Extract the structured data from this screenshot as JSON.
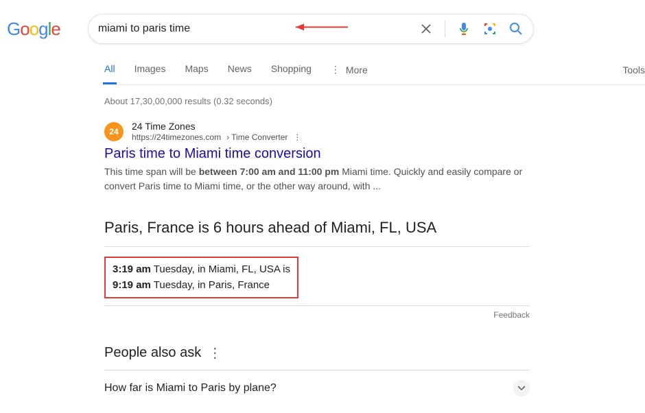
{
  "search": {
    "query": "miami to paris time",
    "logo_text": "Google"
  },
  "tabs": {
    "all": "All",
    "images": "Images",
    "maps": "Maps",
    "news": "News",
    "shopping": "Shopping",
    "more": "More",
    "tools": "Tools"
  },
  "stats": "About 17,30,00,000 results (0.32 seconds)",
  "result": {
    "favicon_text": "24",
    "site_name": "24 Time Zones",
    "url": "https://24timezones.com",
    "breadcrumb": "› Time Converter",
    "title": "Paris time to Miami time conversion",
    "snippet_pre": "This time span will be ",
    "snippet_bold": "between 7:00 am and 11:00 pm",
    "snippet_post": " Miami time. Quickly and easily compare or convert Paris time to Miami time, or the other way around, with ..."
  },
  "answer": {
    "heading": "Paris, France is 6 hours ahead of Miami, FL, USA",
    "line1_time": "3:19 am",
    "line1_rest": " Tuesday, in Miami, FL, USA is",
    "line2_time": "9:19 am",
    "line2_rest": " Tuesday, in Paris, France",
    "feedback": "Feedback"
  },
  "paa": {
    "heading": "People also ask",
    "q1": "How far is Miami to Paris by plane?"
  }
}
